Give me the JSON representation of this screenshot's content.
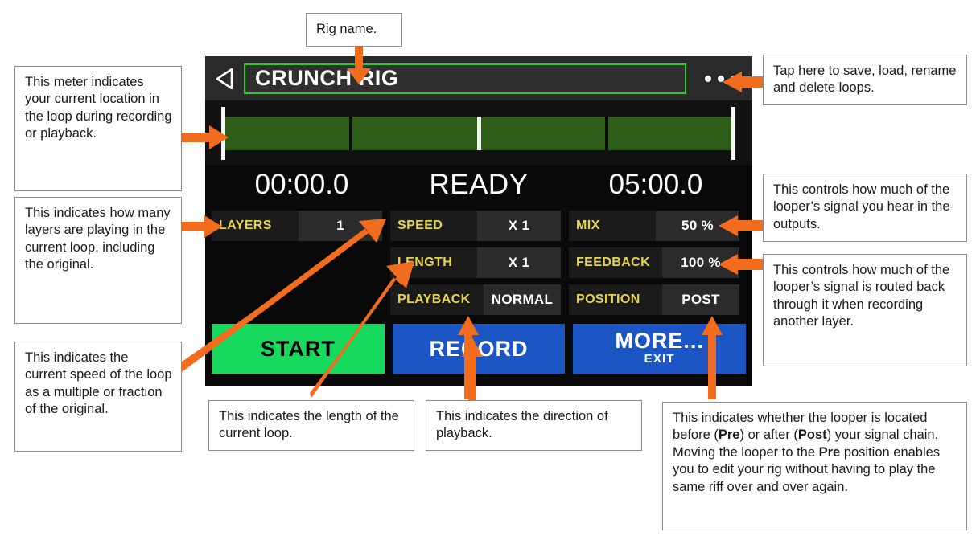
{
  "device": {
    "titlebar": {
      "back_icon": "back-triangle-icon",
      "rig_name": "CRUNCH RIG",
      "menu_icon": "three-dots-icon"
    },
    "meter": {
      "name": "loop-position-meter",
      "segments": 4,
      "playhead_percent": 0,
      "mid_tick_percent": 50
    },
    "time": {
      "elapsed": "00:00.0",
      "status": "READY",
      "total": "05:00.0"
    },
    "params": {
      "col1": [
        {
          "label": "LAYERS",
          "value": "1",
          "name": "layers"
        }
      ],
      "col2": [
        {
          "label": "SPEED",
          "value": "X 1",
          "name": "speed"
        },
        {
          "label": "LENGTH",
          "value": "X 1",
          "name": "length"
        },
        {
          "label": "PLAYBACK",
          "value": "NORMAL",
          "name": "playback"
        }
      ],
      "col3": [
        {
          "label": "MIX",
          "value": "50 %",
          "name": "mix"
        },
        {
          "label": "FEEDBACK",
          "value": "100 %",
          "name": "feedback"
        },
        {
          "label": "POSITION",
          "value": "POST",
          "name": "position"
        }
      ]
    },
    "buttons": {
      "start": {
        "main": "START",
        "sub": ""
      },
      "record": {
        "main": "RECORD",
        "sub": ""
      },
      "more": {
        "main": "MORE...",
        "sub": "EXIT"
      }
    }
  },
  "callouts": {
    "rig_name": "Rig name.",
    "meter": "This meter indicates your current location in the loop during recording or playback.",
    "layers": "This indicates how many layers are playing in the current loop, including the original.",
    "speed": "This indicates the current speed of the loop as a multiple or fraction of the original.",
    "menu": "Tap here to save, load, rename and delete loops.",
    "mix": "This controls how much of the looper’s signal you hear in the outputs.",
    "feedback": "This controls how much of the looper’s signal is routed back through it when recording another layer.",
    "length": "This indicates the length of the current loop.",
    "playback": "This indicates the direction of playback.",
    "position_html": "This indicates whether the looper is located before (<b>Pre</b>) or after (<b>Post</b>) your signal chain. Moving the looper to the <b>Pre</b> position enables you to edit your rig without having to play the same riff over and over again."
  },
  "colors": {
    "accent_arrow": "#F26C1E",
    "rig_border_green": "#2ECC28",
    "meter_green": "#2C5C18",
    "label_yellow": "#E8D44A",
    "start_green": "#17D95E",
    "button_blue": "#1B56C4"
  }
}
